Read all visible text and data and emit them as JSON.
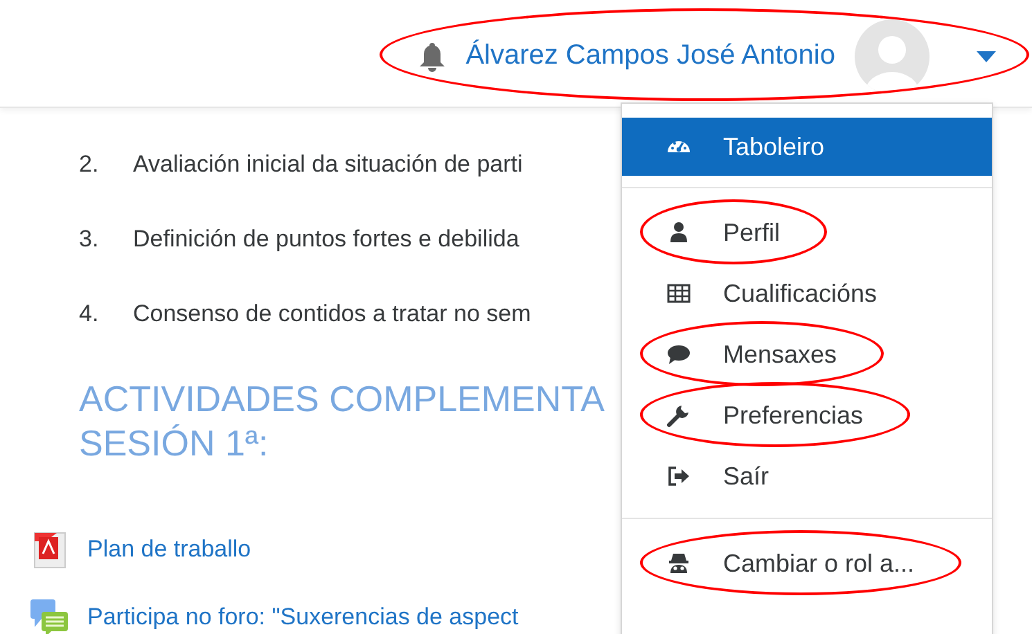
{
  "header": {
    "user_name": "Álvarez Campos José Antonio",
    "highlighted": true
  },
  "content": {
    "steps": [
      {
        "number": "2.",
        "text": "Avaliación inicial da situación de parti"
      },
      {
        "number": "3.",
        "text": "Definición de puntos fortes e debilida"
      },
      {
        "number": "4.",
        "text": "Consenso de contidos a tratar no sem"
      }
    ],
    "heading": [
      "ACTIVIDADES COMPLEMENTA",
      "SESIÓN 1ª:"
    ],
    "activities": [
      {
        "label": "Plan de traballo"
      },
      {
        "label": "Participa no foro: \"Suxerencias de aspect"
      }
    ]
  },
  "user_menu": {
    "groups": [
      [
        {
          "label": "Taboleiro",
          "selected": true,
          "highlighted": false
        }
      ],
      [
        {
          "label": "Perfil",
          "selected": false,
          "highlighted": true
        },
        {
          "label": "Cualificacións",
          "selected": false,
          "highlighted": false
        },
        {
          "label": "Mensaxes",
          "selected": false,
          "highlighted": true
        },
        {
          "label": "Preferencias",
          "selected": false,
          "highlighted": true
        },
        {
          "label": "Saír",
          "selected": false,
          "highlighted": false
        }
      ],
      [
        {
          "label": "Cambiar o rol a...",
          "selected": false,
          "highlighted": true
        }
      ]
    ]
  }
}
